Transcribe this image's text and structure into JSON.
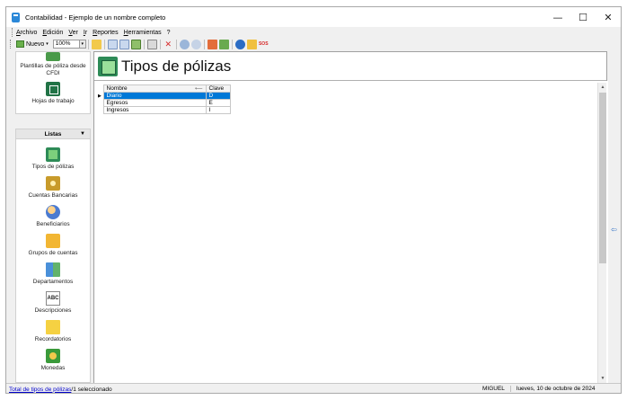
{
  "window": {
    "title": "Contabilidad - Ejemplo de un nombre completo",
    "minimize": "—",
    "maximize": "☐",
    "close": "✕"
  },
  "menu": [
    "Archivo",
    "Edición",
    "Ver",
    "Ir",
    "Reportes",
    "Herramientas",
    "?"
  ],
  "toolbar": {
    "new_label": "Nuevo",
    "new_dropdown": "▾",
    "zoom_value": "100%",
    "zoom_dropdown": "▾"
  },
  "sidebar": {
    "top_items": [
      {
        "label": "Plantillas de póliza desde CFDI",
        "icon": "template-icon"
      },
      {
        "label": "Hojas de trabajo",
        "icon": "spreadsheet-icon"
      }
    ],
    "listas_header": "Listas",
    "listas_arrow": "▼",
    "listas_items": [
      {
        "label": "Tipos de pólizas",
        "icon": "policy-types-icon"
      },
      {
        "label": "Cuentas Bancarias",
        "icon": "bank-accounts-icon"
      },
      {
        "label": "Beneficiarios",
        "icon": "beneficiaries-icon"
      },
      {
        "label": "Grupos de cuentas",
        "icon": "account-groups-icon"
      },
      {
        "label": "Departamentos",
        "icon": "departments-icon"
      },
      {
        "label": "Descripciones",
        "icon": "descriptions-icon"
      },
      {
        "label": "Recordatorios",
        "icon": "reminders-icon"
      },
      {
        "label": "Monedas",
        "icon": "currencies-icon"
      }
    ]
  },
  "main": {
    "title": "Tipos de pólizas",
    "table": {
      "columns": [
        "Nombre",
        "Clave"
      ],
      "rows": [
        {
          "nombre": "Diario",
          "clave": "D",
          "selected": true
        },
        {
          "nombre": "Egresos",
          "clave": "E",
          "selected": false
        },
        {
          "nombre": "Ingresos",
          "clave": "I",
          "selected": false
        }
      ],
      "row_indicator": "▶",
      "sort_indicator": "⟵"
    }
  },
  "status": {
    "link": "Total de tipos de pólizas",
    "selection": "/1 seleccionado",
    "user": "MIGUEL",
    "date": "lueves, 10 de octubre de 2024"
  },
  "colors": {
    "selection": "#0078d7",
    "link": "#0000cc"
  }
}
